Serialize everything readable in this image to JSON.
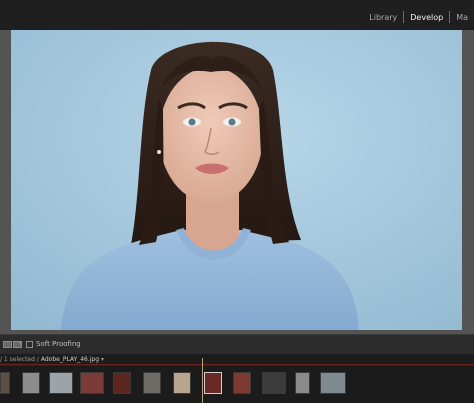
{
  "header": {
    "modules": [
      {
        "label": "Library",
        "active": false
      },
      {
        "label": "Develop",
        "active": true
      },
      {
        "label": "Ma",
        "active": false
      }
    ]
  },
  "photo": {
    "background": "#a4c7dc",
    "subject": "portrait-photo"
  },
  "toolbar": {
    "caret": "▾",
    "soft_proofing_label": "Soft Proofing"
  },
  "filmstrip": {
    "selection_info": "/ 1 selected /",
    "filename": "Adobe_PLAY_46.jpg",
    "filename_caret": "▾",
    "thumbnails": [
      {
        "color": "#5a5046",
        "selected": false
      },
      {
        "color": "#8d8d8d",
        "selected": false
      },
      {
        "color": "#9aa4aa",
        "selected": false
      },
      {
        "color": "#7a3a35",
        "selected": false
      },
      {
        "color": "#5c2620",
        "selected": false
      },
      {
        "color": "#6e6a66",
        "selected": false
      },
      {
        "color": "#b8a58e",
        "selected": false
      },
      {
        "color": "#6a2a24",
        "selected": false
      },
      {
        "color": "#7d3a33",
        "selected": false
      },
      {
        "color": "#3b3b3b",
        "selected": false
      },
      {
        "color": "#8a8a8a",
        "selected": false
      },
      {
        "color": "#7d8a90",
        "selected": false
      }
    ]
  }
}
